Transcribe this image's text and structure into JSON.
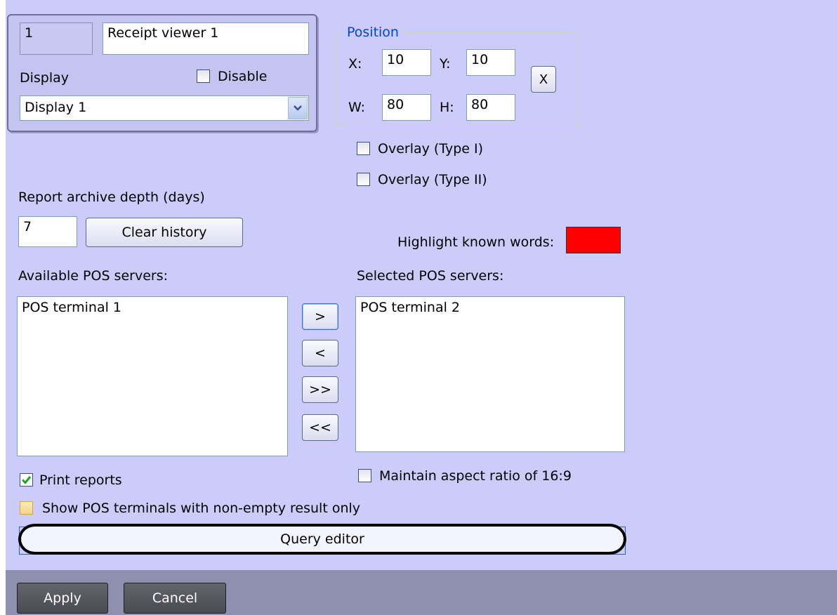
{
  "viewer": {
    "id": "1",
    "name": "Receipt viewer 1",
    "display_label": "Display",
    "disable_label": "Disable",
    "display_value": "Display 1"
  },
  "position": {
    "legend": "Position",
    "x_label": "X:",
    "x_value": "10",
    "y_label": "Y:",
    "y_value": "10",
    "w_label": "W:",
    "w_value": "80",
    "h_label": "H:",
    "h_value": "80",
    "reset_label": "X"
  },
  "overlay": {
    "type1_label": "Overlay (Type I)",
    "type2_label": "Overlay (Type II)"
  },
  "archive": {
    "label": "Report archive depth (days)",
    "value": "7",
    "clear_label": "Clear history"
  },
  "highlight": {
    "label": "Highlight known words:",
    "color": "#ff0000"
  },
  "servers": {
    "available_label": "Available POS servers:",
    "available": [
      "POS terminal 1"
    ],
    "selected_label": "Selected POS servers:",
    "selected": [
      "POS terminal 2"
    ],
    "move_right": ">",
    "move_left": "<",
    "move_all_right": ">>",
    "move_all_left": "<<"
  },
  "options": {
    "print_reports_label": "Print reports",
    "print_reports_checked": true,
    "aspect_label": "Maintain aspect ratio of 16:9",
    "non_empty_label": "Show POS terminals with non-empty result only"
  },
  "query_editor_label": "Query editor",
  "footer": {
    "apply_label": "Apply",
    "cancel_label": "Cancel"
  },
  "colors": {
    "panel_bg": "#ccccfa",
    "footer_bg": "#8f8faf",
    "accent": "#0046d5"
  }
}
